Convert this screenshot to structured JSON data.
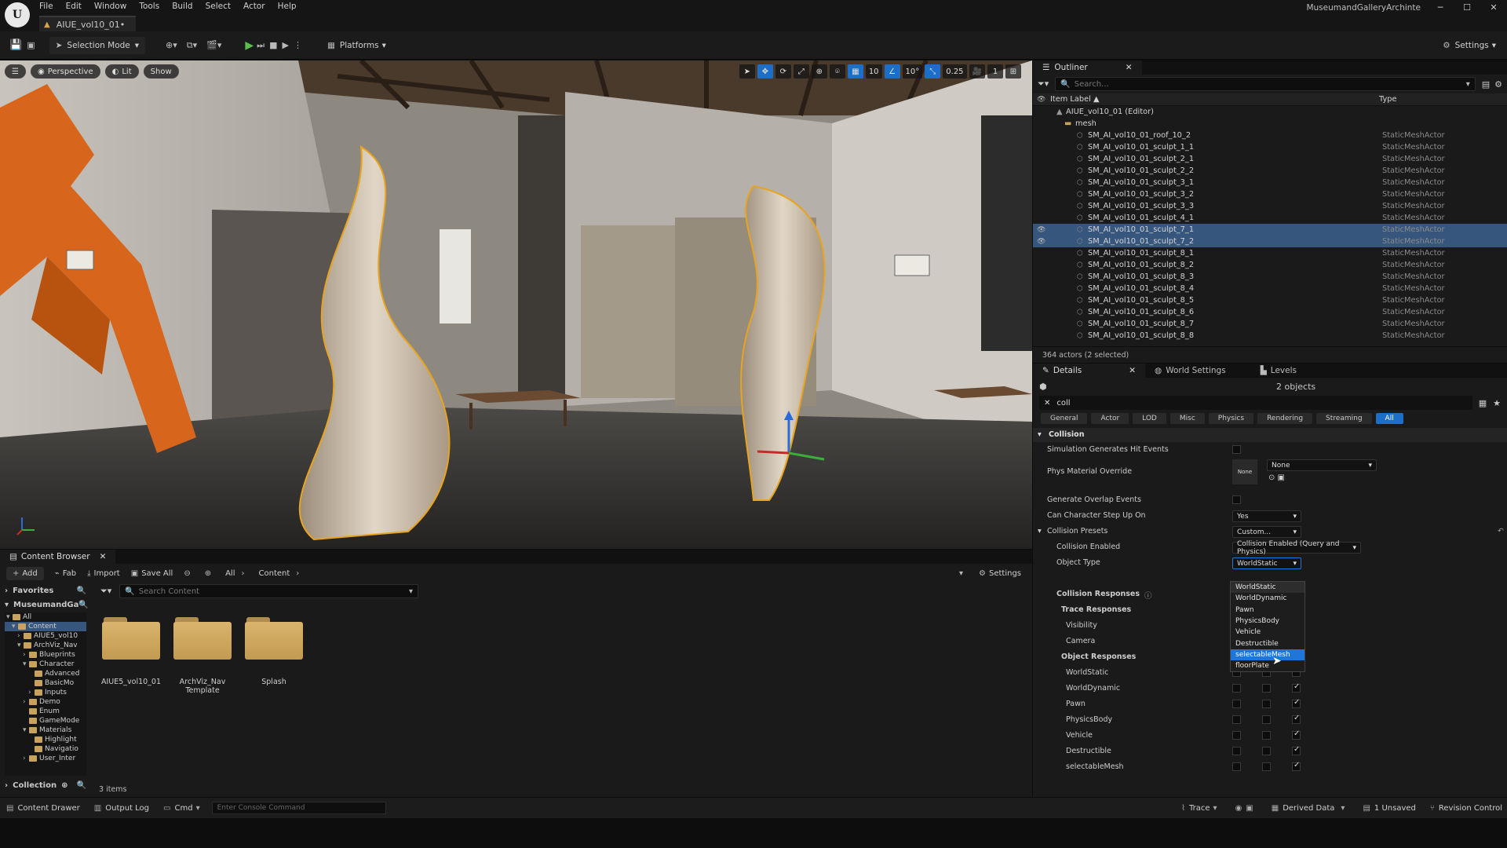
{
  "app": {
    "project_name": "MuseumandGalleryArchinte",
    "doc_tab": "AIUE_vol10_01•",
    "menu": [
      "File",
      "Edit",
      "Window",
      "Tools",
      "Build",
      "Select",
      "Actor",
      "Help"
    ]
  },
  "toolbar": {
    "selection_mode": "Selection Mode",
    "platforms": "Platforms",
    "settings": "Settings"
  },
  "viewport": {
    "perspective": "Perspective",
    "lit": "Lit",
    "show": "Show",
    "grid_snap": "10",
    "rot_snap": "10°",
    "scale_snap": "0.25",
    "cam_speed": "1"
  },
  "outliner": {
    "tab": "Outliner",
    "search_placeholder": "Search...",
    "col_label": "Item Label ▲",
    "col_type": "Type",
    "level": "AIUE_vol10_01 (Editor)",
    "folder": "mesh",
    "rows": [
      {
        "name": "SM_AI_vol10_01_roof_10_2",
        "type": "StaticMeshActor",
        "selected": false
      },
      {
        "name": "SM_AI_vol10_01_sculpt_1_1",
        "type": "StaticMeshActor",
        "selected": false
      },
      {
        "name": "SM_AI_vol10_01_sculpt_2_1",
        "type": "StaticMeshActor",
        "selected": false
      },
      {
        "name": "SM_AI_vol10_01_sculpt_2_2",
        "type": "StaticMeshActor",
        "selected": false
      },
      {
        "name": "SM_AI_vol10_01_sculpt_3_1",
        "type": "StaticMeshActor",
        "selected": false
      },
      {
        "name": "SM_AI_vol10_01_sculpt_3_2",
        "type": "StaticMeshActor",
        "selected": false
      },
      {
        "name": "SM_AI_vol10_01_sculpt_3_3",
        "type": "StaticMeshActor",
        "selected": false
      },
      {
        "name": "SM_AI_vol10_01_sculpt_4_1",
        "type": "StaticMeshActor",
        "selected": false
      },
      {
        "name": "SM_AI_vol10_01_sculpt_7_1",
        "type": "StaticMeshActor",
        "selected": true
      },
      {
        "name": "SM_AI_vol10_01_sculpt_7_2",
        "type": "StaticMeshActor",
        "selected": true
      },
      {
        "name": "SM_AI_vol10_01_sculpt_8_1",
        "type": "StaticMeshActor",
        "selected": false
      },
      {
        "name": "SM_AI_vol10_01_sculpt_8_2",
        "type": "StaticMeshActor",
        "selected": false
      },
      {
        "name": "SM_AI_vol10_01_sculpt_8_3",
        "type": "StaticMeshActor",
        "selected": false
      },
      {
        "name": "SM_AI_vol10_01_sculpt_8_4",
        "type": "StaticMeshActor",
        "selected": false
      },
      {
        "name": "SM_AI_vol10_01_sculpt_8_5",
        "type": "StaticMeshActor",
        "selected": false
      },
      {
        "name": "SM_AI_vol10_01_sculpt_8_6",
        "type": "StaticMeshActor",
        "selected": false
      },
      {
        "name": "SM_AI_vol10_01_sculpt_8_7",
        "type": "StaticMeshActor",
        "selected": false
      },
      {
        "name": "SM_AI_vol10_01_sculpt_8_8",
        "type": "StaticMeshActor",
        "selected": false
      }
    ],
    "footer": "364 actors (2 selected)"
  },
  "details": {
    "tabs": [
      "Details",
      "World Settings",
      "Levels"
    ],
    "objects": "2 objects",
    "search_value": "coll",
    "filters": [
      "General",
      "Actor",
      "LOD",
      "Misc",
      "Physics",
      "Rendering",
      "Streaming",
      "All"
    ],
    "section": "Collision",
    "sim_hit": "Simulation Generates Hit Events",
    "phys_mat": "Phys Material Override",
    "phys_thumb": "None",
    "phys_value": "None",
    "gen_overlap": "Generate Overlap Events",
    "step_up": "Can Character Step Up On",
    "step_up_value": "Yes",
    "presets": "Collision Presets",
    "presets_value": "Custom...",
    "coll_enabled": "Collision Enabled",
    "coll_enabled_value": "Collision Enabled (Query and Physics)",
    "object_type": "Object Type",
    "object_type_value": "WorldStatic",
    "responses": "Collision Responses",
    "trace": "Trace Responses",
    "visibility": "Visibility",
    "camera": "Camera",
    "object_resp": "Object Responses",
    "resp_rows": [
      "WorldStatic",
      "WorldDynamic",
      "Pawn",
      "PhysicsBody",
      "Vehicle",
      "Destructible",
      "selectableMesh"
    ]
  },
  "dropdown": {
    "options": [
      "WorldStatic",
      "WorldDynamic",
      "Pawn",
      "PhysicsBody",
      "Vehicle",
      "Destructible",
      "selectableMesh",
      "floorPlate"
    ],
    "highlighted": "selectableMesh"
  },
  "content_browser": {
    "tab": "Content Browser",
    "add": "Add",
    "fab": "Fab",
    "import": "Import",
    "save_all": "Save All",
    "crumb_all": "All",
    "crumb_content": "Content",
    "settings": "Settings",
    "favorites": "Favorites",
    "project_root": "MuseumandGa",
    "search_placeholder": "Search Content",
    "collections": "Collection",
    "item_count": "3 items",
    "tree": [
      "All",
      "Content",
      "AIUE5_vol10",
      "ArchViz_Nav",
      "Blueprints",
      "Character",
      "Advanced",
      "BasicMo",
      "Inputs",
      "Demo",
      "Enum",
      "GameMode",
      "Materials",
      "Highlight",
      "Navigatio",
      "User_Inter"
    ],
    "folders": [
      {
        "label": "AIUE5_vol10_01"
      },
      {
        "label": "ArchViz_Nav Template"
      },
      {
        "label": "Splash"
      }
    ]
  },
  "status": {
    "content_drawer": "Content Drawer",
    "output_log": "Output Log",
    "cmd": "Cmd",
    "console_placeholder": "Enter Console Command",
    "trace": "Trace",
    "derived": "Derived Data",
    "unsaved": "1 Unsaved",
    "revision": "Revision Control"
  },
  "colors": {
    "accent": "#1c6fc9",
    "selection": "#37567e",
    "folder": "#d9b46c"
  }
}
